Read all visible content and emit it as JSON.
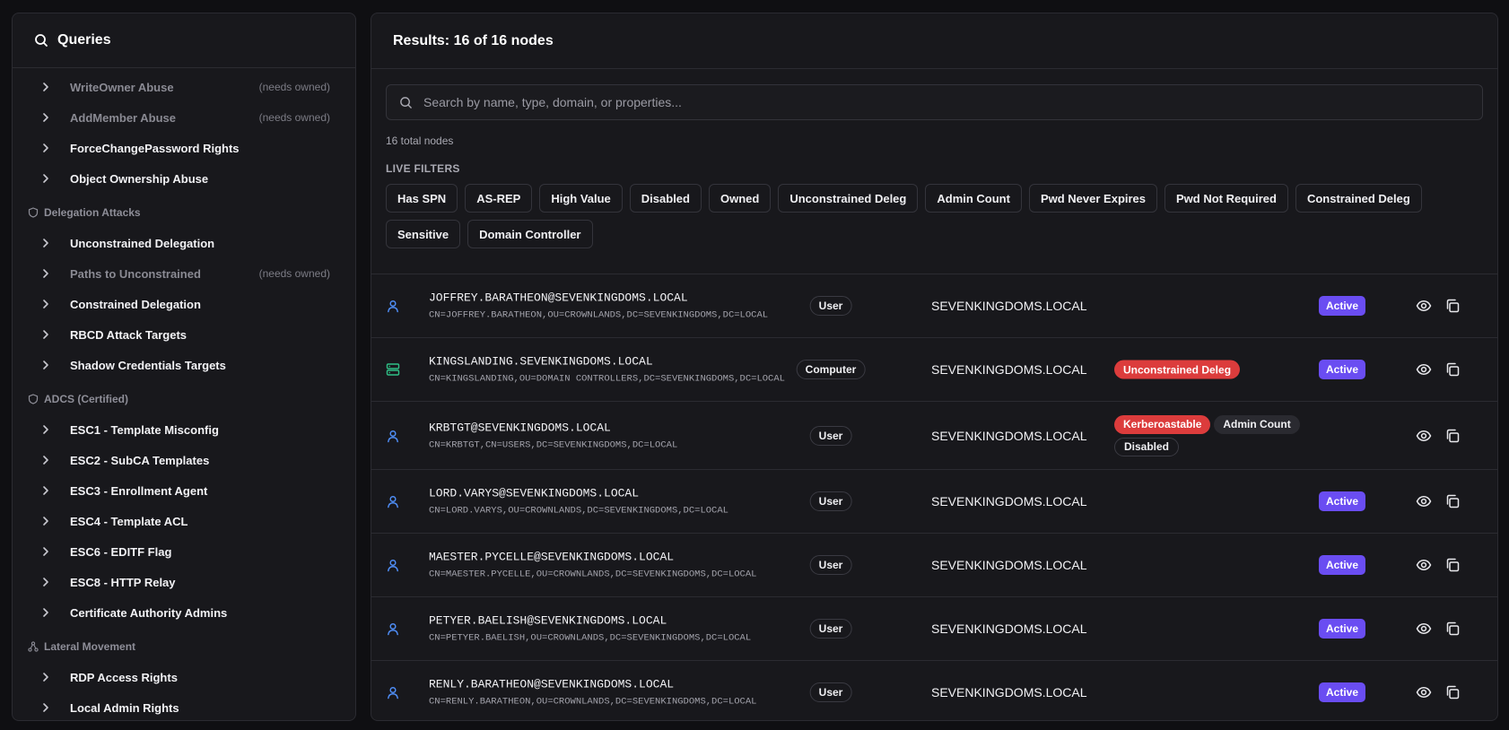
{
  "sidebar": {
    "title": "Queries",
    "items": [
      {
        "kind": "item",
        "label": "WriteOwner Abuse",
        "note": "(needs owned)",
        "dim": true
      },
      {
        "kind": "item",
        "label": "AddMember Abuse",
        "note": "(needs owned)",
        "dim": true
      },
      {
        "kind": "item",
        "label": "ForceChangePassword Rights"
      },
      {
        "kind": "item",
        "label": "Object Ownership Abuse"
      },
      {
        "kind": "section",
        "label": "Delegation Attacks",
        "icon": "shield-icon"
      },
      {
        "kind": "item",
        "label": "Unconstrained Delegation"
      },
      {
        "kind": "item",
        "label": "Paths to Unconstrained",
        "note": "(needs owned)",
        "dim": true
      },
      {
        "kind": "item",
        "label": "Constrained Delegation"
      },
      {
        "kind": "item",
        "label": "RBCD Attack Targets"
      },
      {
        "kind": "item",
        "label": "Shadow Credentials Targets"
      },
      {
        "kind": "section",
        "label": "ADCS (Certified)",
        "icon": "shield-icon"
      },
      {
        "kind": "item",
        "label": "ESC1 - Template Misconfig"
      },
      {
        "kind": "item",
        "label": "ESC2 - SubCA Templates"
      },
      {
        "kind": "item",
        "label": "ESC3 - Enrollment Agent"
      },
      {
        "kind": "item",
        "label": "ESC4 - Template ACL"
      },
      {
        "kind": "item",
        "label": "ESC6 - EDITF Flag"
      },
      {
        "kind": "item",
        "label": "ESC8 - HTTP Relay"
      },
      {
        "kind": "item",
        "label": "Certificate Authority Admins"
      },
      {
        "kind": "section",
        "label": "Lateral Movement",
        "icon": "network-icon"
      },
      {
        "kind": "item",
        "label": "RDP Access Rights"
      },
      {
        "kind": "item",
        "label": "Local Admin Rights"
      }
    ]
  },
  "main": {
    "title": "Results: 16 of 16 nodes",
    "search_placeholder": "Search by name, type, domain, or properties...",
    "total": "16 total nodes",
    "filters_title": "LIVE FILTERS",
    "filters": [
      "Has SPN",
      "AS-REP",
      "High Value",
      "Disabled",
      "Owned",
      "Unconstrained Deleg",
      "Admin Count",
      "Pwd Never Expires",
      "Pwd Not Required",
      "Constrained Deleg",
      "Sensitive",
      "Domain Controller"
    ],
    "rows": [
      {
        "icon": "user-icon",
        "name": "JOFFREY.BARATHEON@SEVENKINGDOMS.LOCAL",
        "dn": "CN=JOFFREY.BARATHEON,OU=CROWNLANDS,DC=SEVENKINGDOMS,DC=LOCAL",
        "type": "User",
        "domain": "SEVENKINGDOMS.LOCAL",
        "tags": [],
        "status": "Active"
      },
      {
        "icon": "computer-icon",
        "name": "KINGSLANDING.SEVENKINGDOMS.LOCAL",
        "dn": "CN=KINGSLANDING,OU=DOMAIN CONTROLLERS,DC=SEVENKINGDOMS,DC=LOCAL",
        "type": "Computer",
        "domain": "SEVENKINGDOMS.LOCAL",
        "tags": [
          {
            "label": "Unconstrained Deleg",
            "style": "red"
          }
        ],
        "status": "Active"
      },
      {
        "icon": "user-icon",
        "name": "KRBTGT@SEVENKINGDOMS.LOCAL",
        "dn": "CN=KRBTGT,CN=USERS,DC=SEVENKINGDOMS,DC=LOCAL",
        "type": "User",
        "domain": "SEVENKINGDOMS.LOCAL",
        "tags": [
          {
            "label": "Kerberoastable",
            "style": "red"
          },
          {
            "label": "Admin Count",
            "style": "gray"
          },
          {
            "label": "Disabled",
            "style": "outline"
          }
        ],
        "status": ""
      },
      {
        "icon": "user-icon",
        "name": "LORD.VARYS@SEVENKINGDOMS.LOCAL",
        "dn": "CN=LORD.VARYS,OU=CROWNLANDS,DC=SEVENKINGDOMS,DC=LOCAL",
        "type": "User",
        "domain": "SEVENKINGDOMS.LOCAL",
        "tags": [],
        "status": "Active"
      },
      {
        "icon": "user-icon",
        "name": "MAESTER.PYCELLE@SEVENKINGDOMS.LOCAL",
        "dn": "CN=MAESTER.PYCELLE,OU=CROWNLANDS,DC=SEVENKINGDOMS,DC=LOCAL",
        "type": "User",
        "domain": "SEVENKINGDOMS.LOCAL",
        "tags": [],
        "status": "Active"
      },
      {
        "icon": "user-icon",
        "name": "PETYER.BAELISH@SEVENKINGDOMS.LOCAL",
        "dn": "CN=PETYER.BAELISH,OU=CROWNLANDS,DC=SEVENKINGDOMS,DC=LOCAL",
        "type": "User",
        "domain": "SEVENKINGDOMS.LOCAL",
        "tags": [],
        "status": "Active"
      },
      {
        "icon": "user-icon",
        "name": "RENLY.BARATHEON@SEVENKINGDOMS.LOCAL",
        "dn": "CN=RENLY.BARATHEON,OU=CROWNLANDS,DC=SEVENKINGDOMS,DC=LOCAL",
        "type": "User",
        "domain": "SEVENKINGDOMS.LOCAL",
        "tags": [],
        "status": "Active"
      }
    ]
  },
  "colors": {
    "accent": "#6a4df2",
    "danger": "#dc3c3c",
    "user_icon": "#4f8ef7",
    "computer_icon": "#2fbf86"
  }
}
